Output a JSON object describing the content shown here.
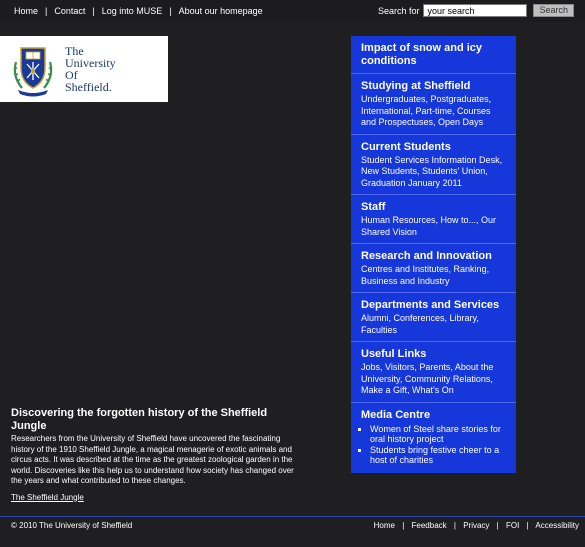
{
  "topnav": {
    "links": [
      "Home",
      "Contact",
      "Log into MUSE",
      "About our homepage"
    ],
    "separator": "|"
  },
  "search": {
    "label": "Search for",
    "value": "your search",
    "button": "Search"
  },
  "logo": {
    "line1": "The",
    "line2": "University",
    "line3": "Of",
    "line4": "Sheffield."
  },
  "sidemenu": {
    "alert": "Impact of snow and icy conditions",
    "sections": [
      {
        "heading": "Studying at Sheffield",
        "links": "Undergraduates, Postgraduates, International, Part-time, Courses and Prospectuses, Open Days"
      },
      {
        "heading": "Current Students",
        "links": "Student Services Information Desk, New Students, Students' Union, Graduation January 2011"
      },
      {
        "heading": "Staff",
        "links": "Human Resources, How to..., Our Shared Vision"
      },
      {
        "heading": "Research and Innovation",
        "links": "Centres and Institutes, Ranking, Business and Industry"
      },
      {
        "heading": "Departments and Services",
        "links": "Alumni, Conferences, Library, Faculties"
      },
      {
        "heading": "Useful Links",
        "links": "Jobs, Visitors, Parents, About the University, Community Relations, Make a Gift, What's On"
      }
    ],
    "media": {
      "heading": "Media Centre",
      "items": [
        "Women of Steel share stories for oral history project",
        "Students bring festive cheer to a host of charities"
      ]
    }
  },
  "feature": {
    "title": "Discovering the forgotten history of the Sheffield Jungle",
    "body": "Researchers from the University of Sheffield have uncovered the fascinating history of the 1910 Sheffield Jungle, a magical menagerie of exotic animals and circus acts. It was described at the time as the greatest zoological garden in the world. Discoveries like this help us to understand how society has changed over the years and what contributed to these changes.",
    "link": "The Sheffield Jungle"
  },
  "footer": {
    "copyright": "© 2010 The University of Sheffield",
    "links": [
      "Home",
      "Feedback",
      "Privacy",
      "FOI",
      "Accessibility"
    ],
    "separator": "|"
  },
  "colors": {
    "background": "#1f1f21",
    "menu": "#1637d9",
    "logo_text": "#1a3a6b"
  }
}
